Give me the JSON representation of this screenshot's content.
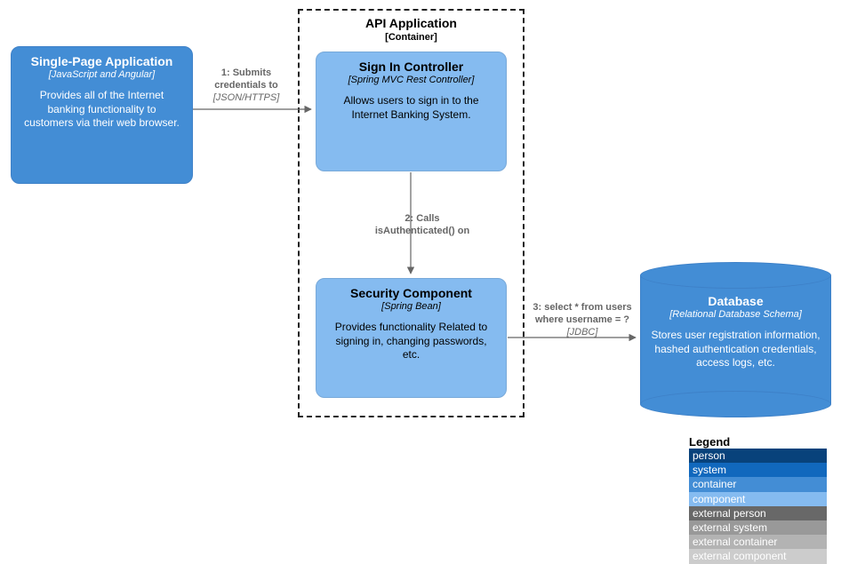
{
  "boundary": {
    "title": "API Application",
    "subtitle": "[Container]"
  },
  "spa": {
    "title": "Single-Page Application",
    "tech": "[JavaScript and Angular]",
    "desc": "Provides all of the Internet banking functionality to customers via their web browser."
  },
  "signin": {
    "title": "Sign In Controller",
    "tech": "[Spring MVC Rest Controller]",
    "desc": "Allows users to sign in to the Internet Banking System."
  },
  "security": {
    "title": "Security Component",
    "tech": "[Spring Bean]",
    "desc": "Provides functionality Related to signing in, changing passwords, etc."
  },
  "database": {
    "title": "Database",
    "tech": "[Relational Database Schema]",
    "desc": "Stores user registration information, hashed authentication credentials, access logs, etc."
  },
  "edges": {
    "e1": {
      "line1": "1: Submits",
      "line2": "credentials to",
      "tech": "[JSON/HTTPS]"
    },
    "e2": {
      "line1": "2: Calls",
      "line2": "isAuthenticated() on"
    },
    "e3": {
      "line1": "3: select * from users",
      "line2": "where username = ?",
      "tech": "[JDBC]"
    }
  },
  "legend": {
    "title": "Legend",
    "items": [
      {
        "label": "person",
        "color": "#08427b"
      },
      {
        "label": "system",
        "color": "#1168bd"
      },
      {
        "label": "container",
        "color": "#438dd5"
      },
      {
        "label": "component",
        "color": "#85bbf0"
      },
      {
        "label": "external person",
        "color": "#686868"
      },
      {
        "label": "external system",
        "color": "#999999"
      },
      {
        "label": "external container",
        "color": "#b3b3b3"
      },
      {
        "label": "external component",
        "color": "#cccccc"
      }
    ]
  }
}
